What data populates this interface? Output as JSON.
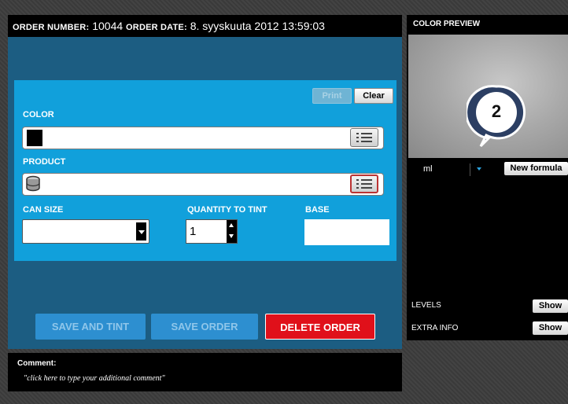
{
  "header": {
    "order_number_label": "ORDER NUMBER:",
    "order_number": "10044",
    "order_date_label": "ORDER DATE:",
    "order_date": "8. syyskuuta 2012 13:59:03"
  },
  "form": {
    "print_label": "Print",
    "clear_label": "Clear",
    "color_label": "COLOR",
    "product_label": "PRODUCT",
    "can_size_label": "CAN SIZE",
    "can_size_value": "",
    "quantity_label": "QUANTITY TO TINT",
    "quantity_value": "1",
    "base_label": "BASE",
    "base_value": ""
  },
  "actions": {
    "save_and_tint": "SAVE AND TINT",
    "save_order": "SAVE ORDER",
    "delete_order": "DELETE ORDER"
  },
  "comment": {
    "label": "Comment:",
    "placeholder": "\"click here to type your additional comment\""
  },
  "preview": {
    "title": "COLOR PREVIEW",
    "badge_number": "2",
    "unit": "ml",
    "new_formula": "New formula",
    "levels_label": "LEVELS",
    "levels_button": "Show",
    "extra_info_label": "EXTRA INFO",
    "extra_info_button": "Show"
  },
  "colors": {
    "form_bg": "#11a0db",
    "panel_dark": "#1c5d82",
    "delete_red": "#e0101a",
    "save_blue": "#2d8fd0"
  }
}
